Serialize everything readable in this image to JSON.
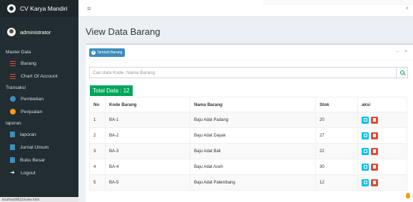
{
  "brand": "CV Karya Mandiri",
  "user": "administrator",
  "sidebar": {
    "sections": [
      {
        "header": "Master Data",
        "items": [
          {
            "label": "Barang",
            "icon": "grid-icon"
          },
          {
            "label": "Chart Of Account",
            "icon": "grid-icon"
          }
        ]
      },
      {
        "header": "Transaksi",
        "items": [
          {
            "label": "Pembelian",
            "icon": "circle-icon"
          },
          {
            "label": "Penjualan",
            "icon": "circle-icon"
          }
        ]
      },
      {
        "header": "laporan",
        "items": [
          {
            "label": "laporan",
            "icon": "file-icon"
          },
          {
            "label": "Jurnal Umum",
            "icon": "file-icon"
          },
          {
            "label": "Buku Besar",
            "icon": "file-icon"
          },
          {
            "label": "Logout",
            "icon": "logout-icon"
          }
        ]
      }
    ]
  },
  "statusbar": "localhost/8022/index.html",
  "topbar": {
    "menu_icon": "≡",
    "close_icon": "×"
  },
  "page_title": "View Data Barang",
  "box": {
    "add_button": "Tambah Barang",
    "tools": [
      "–",
      "×"
    ],
    "search_placeholder": "Cari data Kode, Nama Barang",
    "total": "Total Data : 12"
  },
  "table": {
    "headers": [
      "No",
      "Kode Barang",
      "Nama Barang",
      "Stok",
      "aksi"
    ],
    "rows": [
      [
        "1",
        "BA-1",
        "Baju Adat Padang",
        "20"
      ],
      [
        "2",
        "BA-2",
        "Baju Adat Dayak",
        "27"
      ],
      [
        "3",
        "BA-3",
        "Baju Adat Bali",
        "22"
      ],
      [
        "4",
        "BA-4",
        "Baju Adat Aceh",
        "30"
      ],
      [
        "5",
        "BA-5",
        "Baju Adat Palembang",
        "12"
      ]
    ]
  },
  "colors": {
    "sidebar": "#222d32",
    "primary": "#3c8dbc",
    "success": "#00a65a",
    "info": "#00c0ef",
    "danger": "#dd4b39"
  }
}
